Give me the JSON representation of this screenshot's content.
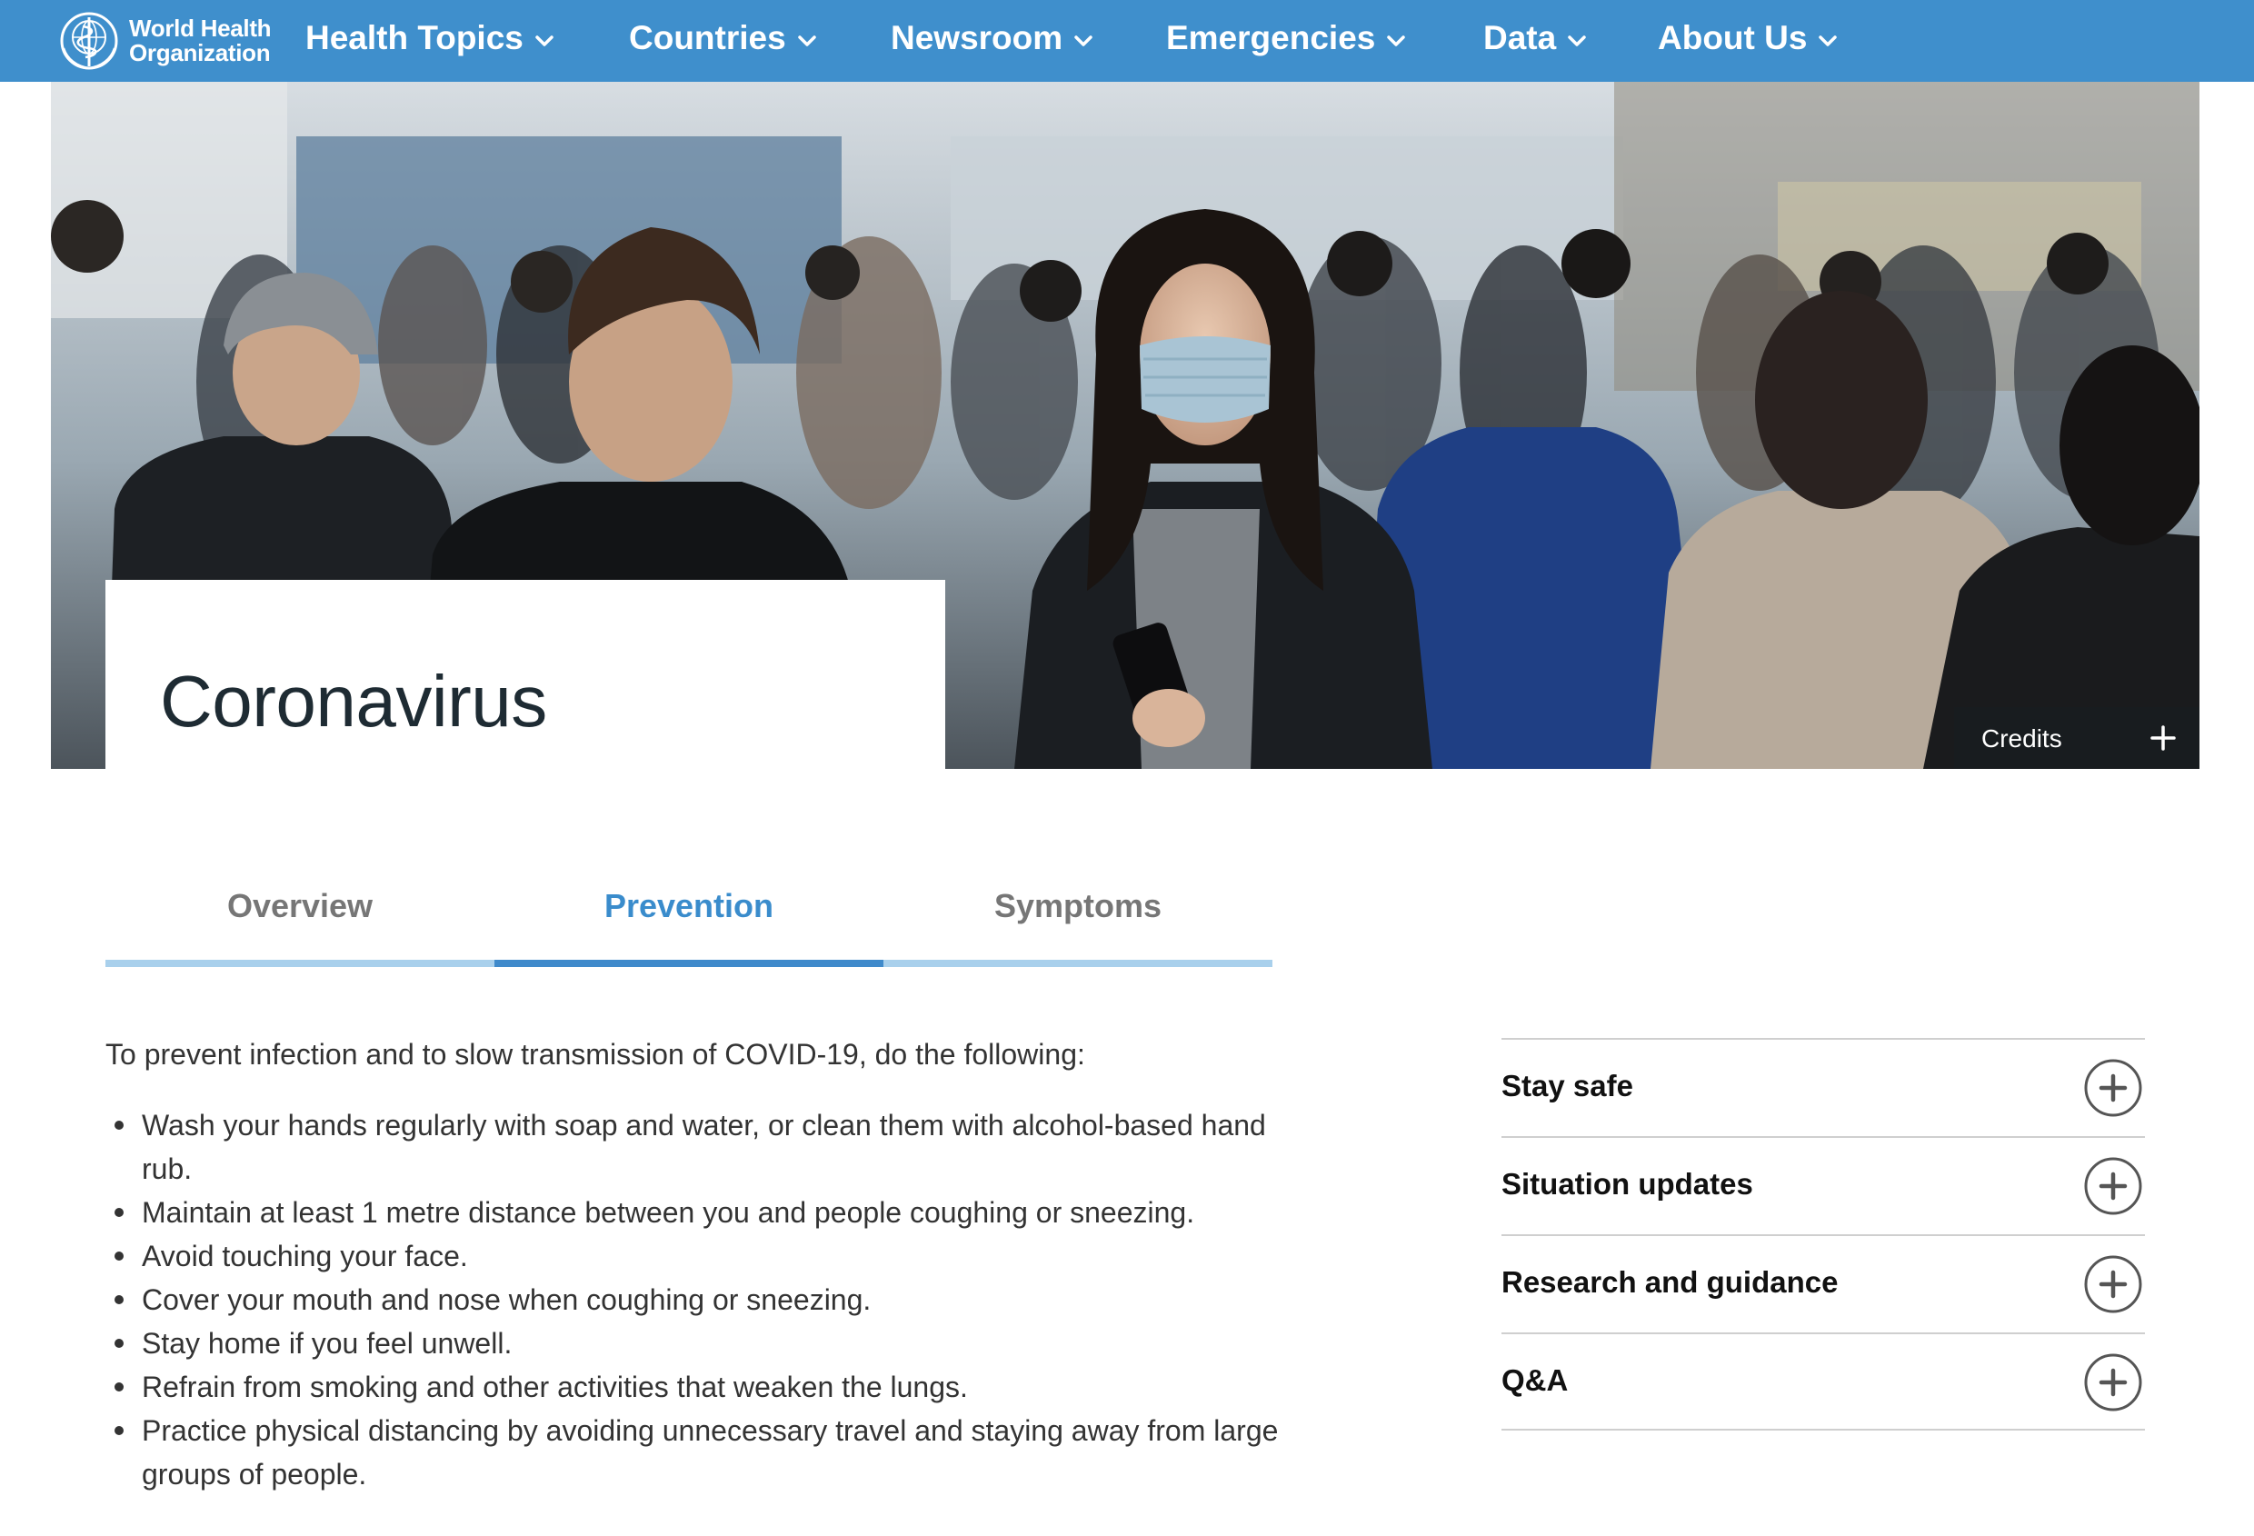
{
  "header": {
    "logo_line1": "World Health",
    "logo_line2": "Organization",
    "nav": [
      {
        "label": "Health Topics"
      },
      {
        "label": "Countries"
      },
      {
        "label": "Newsroom"
      },
      {
        "label": "Emergencies"
      },
      {
        "label": "Data"
      },
      {
        "label": "About Us"
      }
    ]
  },
  "hero": {
    "title": "Coronavirus",
    "credits_label": "Credits"
  },
  "tabs": [
    {
      "label": "Overview",
      "active": false
    },
    {
      "label": "Prevention",
      "active": true
    },
    {
      "label": "Symptoms",
      "active": false
    }
  ],
  "content": {
    "intro": "To prevent infection and to slow transmission of COVID-19, do the following:",
    "items": [
      "Wash your hands regularly with soap and water, or clean them with alcohol-based hand rub.",
      "Maintain at least 1 metre distance between you and people coughing or sneezing.",
      "Avoid touching your face.",
      "Cover your mouth and nose when coughing or sneezing.",
      "Stay home if you feel unwell.",
      "Refrain from smoking and other activities that weaken the lungs.",
      "Practice physical distancing by avoiding unnecessary travel and staying away from large groups of people."
    ]
  },
  "sidebar": {
    "accordion": [
      {
        "label": "Stay safe"
      },
      {
        "label": "Situation updates"
      },
      {
        "label": "Research and guidance"
      },
      {
        "label": "Q&A"
      }
    ]
  },
  "colors": {
    "nav_bg": "#3f8fcc",
    "active_tab": "#3a8ccc",
    "inactive_underline": "#a9d0ec",
    "text": "#333333"
  }
}
